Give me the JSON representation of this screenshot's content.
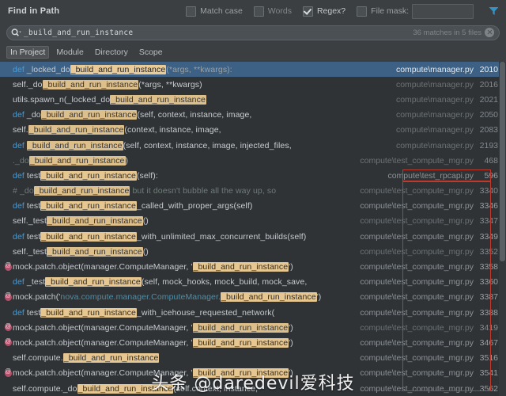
{
  "dialog": {
    "title": "Find in Path"
  },
  "options": [
    {
      "label": "Match case",
      "checked": false,
      "name": "match-case"
    },
    {
      "label": "Words",
      "checked": false,
      "name": "words"
    },
    {
      "label": "Regex?",
      "checked": true,
      "name": "regex"
    },
    {
      "label": "File mask:",
      "checked": false,
      "name": "file-mask"
    }
  ],
  "file_mask": {
    "value": "",
    "placeholder": ""
  },
  "search": {
    "value": "_build_and_run_instance",
    "placeholder": "",
    "match_count": "36 matches in 5 files",
    "search_icon": "search-icon",
    "clear_icon": "clear-icon",
    "filter_icon": "filter-icon"
  },
  "scope_tabs": [
    {
      "label": "In Project",
      "active": true
    },
    {
      "label": "Module",
      "active": false
    },
    {
      "label": "Directory",
      "active": false
    },
    {
      "label": "Scope",
      "active": false
    }
  ],
  "results": [
    {
      "selected": true,
      "dim": false,
      "decorator": false,
      "parts": [
        {
          "t": "def ",
          "c": "kw"
        },
        {
          "t": "_locked_do",
          "c": "fn"
        },
        {
          "t": "_build_and_run_instance",
          "c": "hl"
        },
        {
          "t": "(*args, **kwargs):",
          "c": "muted"
        }
      ],
      "file": "compute\\manager.py",
      "line": "2010"
    },
    {
      "selected": false,
      "dim": true,
      "decorator": false,
      "parts": [
        {
          "t": "self._do",
          "c": "fn"
        },
        {
          "t": "_build_and_run_instance",
          "c": "hl"
        },
        {
          "t": "(*args, **kwargs)",
          "c": "fn"
        }
      ],
      "file": "compute\\manager.py",
      "line": "2016"
    },
    {
      "selected": false,
      "dim": true,
      "decorator": false,
      "parts": [
        {
          "t": "utils.spawn_n(_locked_do",
          "c": "fn"
        },
        {
          "t": "_build_and_run_instance",
          "c": "hl"
        }
      ],
      "file": "compute\\manager.py",
      "line": "2021"
    },
    {
      "selected": false,
      "dim": true,
      "decorator": false,
      "parts": [
        {
          "t": "def ",
          "c": "kw"
        },
        {
          "t": "_do",
          "c": "fn"
        },
        {
          "t": "_build_and_run_instance",
          "c": "hl"
        },
        {
          "t": "(self, context, instance, image,",
          "c": "fn"
        }
      ],
      "file": "compute\\manager.py",
      "line": "2050"
    },
    {
      "selected": false,
      "dim": true,
      "decorator": false,
      "parts": [
        {
          "t": "self.",
          "c": "fn"
        },
        {
          "t": "_build_and_run_instance",
          "c": "hl"
        },
        {
          "t": "(context, instance, image,",
          "c": "fn"
        }
      ],
      "file": "compute\\manager.py",
      "line": "2083"
    },
    {
      "selected": false,
      "dim": true,
      "decorator": false,
      "parts": [
        {
          "t": "def ",
          "c": "kw"
        },
        {
          "t": "_build_and_run_instance",
          "c": "hl"
        },
        {
          "t": "(self, context, instance, image, injected_files,",
          "c": "fn"
        }
      ],
      "file": "compute\\manager.py",
      "line": "2193"
    },
    {
      "selected": false,
      "dim": true,
      "decorator": false,
      "parts": [
        {
          "t": "._do",
          "c": "cm"
        },
        {
          "t": "_build_and_run_instance",
          "c": "hl"
        },
        {
          "t": ")",
          "c": "fn"
        }
      ],
      "file": "compute\\test_compute_mgr.py",
      "line": "468"
    },
    {
      "selected": false,
      "dim": false,
      "decorator": false,
      "parts": [
        {
          "t": "def ",
          "c": "kw"
        },
        {
          "t": "test",
          "c": "fn"
        },
        {
          "t": "_build_and_run_instance",
          "c": "hl"
        },
        {
          "t": "(self):",
          "c": "fn"
        }
      ],
      "file": "compute\\test_rpcapi.py",
      "line": "596"
    },
    {
      "selected": false,
      "dim": true,
      "decorator": false,
      "parts": [
        {
          "t": "# _do",
          "c": "cm"
        },
        {
          "t": "_build_and_run_instance",
          "c": "hl"
        },
        {
          "t": " but it doesn't bubble all the way up, so",
          "c": "cm"
        }
      ],
      "file": "compute\\test_compute_mgr.py",
      "line": "3340"
    },
    {
      "selected": false,
      "dim": false,
      "decorator": false,
      "parts": [
        {
          "t": "def ",
          "c": "kw"
        },
        {
          "t": "test",
          "c": "fn"
        },
        {
          "t": "_build_and_run_instance",
          "c": "hl"
        },
        {
          "t": "_called_with_proper_args(self)",
          "c": "fn"
        }
      ],
      "file": "compute\\test_compute_mgr.py",
      "line": "3346"
    },
    {
      "selected": false,
      "dim": true,
      "decorator": false,
      "parts": [
        {
          "t": "self._test",
          "c": "fn"
        },
        {
          "t": "_build_and_run_instance",
          "c": "hl"
        },
        {
          "t": "()",
          "c": "fn"
        }
      ],
      "file": "compute\\test_compute_mgr.py",
      "line": "3347"
    },
    {
      "selected": false,
      "dim": false,
      "decorator": false,
      "parts": [
        {
          "t": "def ",
          "c": "kw"
        },
        {
          "t": "test",
          "c": "fn"
        },
        {
          "t": "_build_and_run_instance",
          "c": "hl"
        },
        {
          "t": "_with_unlimited_max_concurrent_builds(self)",
          "c": "fn"
        }
      ],
      "file": "compute\\test_compute_mgr.py",
      "line": "3349"
    },
    {
      "selected": false,
      "dim": true,
      "decorator": false,
      "parts": [
        {
          "t": "self._test",
          "c": "fn"
        },
        {
          "t": "_build_and_run_instance",
          "c": "hl"
        },
        {
          "t": "()",
          "c": "fn"
        }
      ],
      "file": "compute\\test_compute_mgr.py",
      "line": "3352"
    },
    {
      "selected": false,
      "dim": false,
      "decorator": true,
      "parts": [
        {
          "t": "mock.patch.object(manager.ComputeManager, '",
          "c": "fn"
        },
        {
          "t": "_build_and_run_instance",
          "c": "hl"
        },
        {
          "t": "')",
          "c": "fn"
        }
      ],
      "file": "compute\\test_compute_mgr.py",
      "line": "3358"
    },
    {
      "selected": false,
      "dim": false,
      "decorator": false,
      "parts": [
        {
          "t": "def ",
          "c": "kw"
        },
        {
          "t": "_test",
          "c": "fn"
        },
        {
          "t": "_build_and_run_instance",
          "c": "hl"
        },
        {
          "t": "(self, mock_hooks, mock_build, mock_save,",
          "c": "fn"
        }
      ],
      "file": "compute\\test_compute_mgr.py",
      "line": "3360"
    },
    {
      "selected": false,
      "dim": false,
      "decorator": true,
      "parts": [
        {
          "t": "mock.patch('",
          "c": "fn"
        },
        {
          "t": "nova.compute.manager.ComputeManager.",
          "c": "cls"
        },
        {
          "t": "_build_and_run_instance",
          "c": "hl"
        },
        {
          "t": "')",
          "c": "fn"
        }
      ],
      "file": "compute\\test_compute_mgr.py",
      "line": "3387"
    },
    {
      "selected": false,
      "dim": false,
      "decorator": false,
      "parts": [
        {
          "t": "def ",
          "c": "kw"
        },
        {
          "t": "test",
          "c": "fn"
        },
        {
          "t": "_build_and_run_instance",
          "c": "hl"
        },
        {
          "t": "_with_icehouse_requested_network(",
          "c": "fn"
        }
      ],
      "file": "compute\\test_compute_mgr.py",
      "line": "3388"
    },
    {
      "selected": false,
      "dim": true,
      "decorator": true,
      "parts": [
        {
          "t": "mock.patch.object(manager.ComputeManager, '",
          "c": "fn"
        },
        {
          "t": "_build_and_run_instance",
          "c": "hl"
        },
        {
          "t": "')",
          "c": "fn"
        }
      ],
      "file": "compute\\test_compute_mgr.py",
      "line": "3419"
    },
    {
      "selected": false,
      "dim": false,
      "decorator": true,
      "parts": [
        {
          "t": "mock.patch.object(manager.ComputeManager, '",
          "c": "fn"
        },
        {
          "t": "_build_and_run_instance",
          "c": "hl"
        },
        {
          "t": "')",
          "c": "fn"
        }
      ],
      "file": "compute\\test_compute_mgr.py",
      "line": "3467"
    },
    {
      "selected": false,
      "dim": false,
      "decorator": false,
      "parts": [
        {
          "t": "self.compute.",
          "c": "fn"
        },
        {
          "t": "_build_and_run_instance",
          "c": "hl"
        }
      ],
      "file": "compute\\test_compute_mgr.py",
      "line": "3516"
    },
    {
      "selected": false,
      "dim": false,
      "decorator": true,
      "parts": [
        {
          "t": "mock.patch.object(manager.ComputeManager, '",
          "c": "fn"
        },
        {
          "t": "_build_and_run_instance",
          "c": "hl"
        },
        {
          "t": "')",
          "c": "fn"
        }
      ],
      "file": "compute\\test_compute_mgr.py",
      "line": "3541"
    },
    {
      "selected": false,
      "dim": false,
      "decorator": false,
      "parts": [
        {
          "t": "self.compute._do",
          "c": "fn"
        },
        {
          "t": "_build_and_run_instance",
          "c": "hl"
        },
        {
          "t": "(self.context, instance,",
          "c": "fn"
        }
      ],
      "file": "compute\\test_compute_mgr.py",
      "line": "3562"
    }
  ],
  "watermark": {
    "text": "头条 @daredevil爱科技"
  }
}
